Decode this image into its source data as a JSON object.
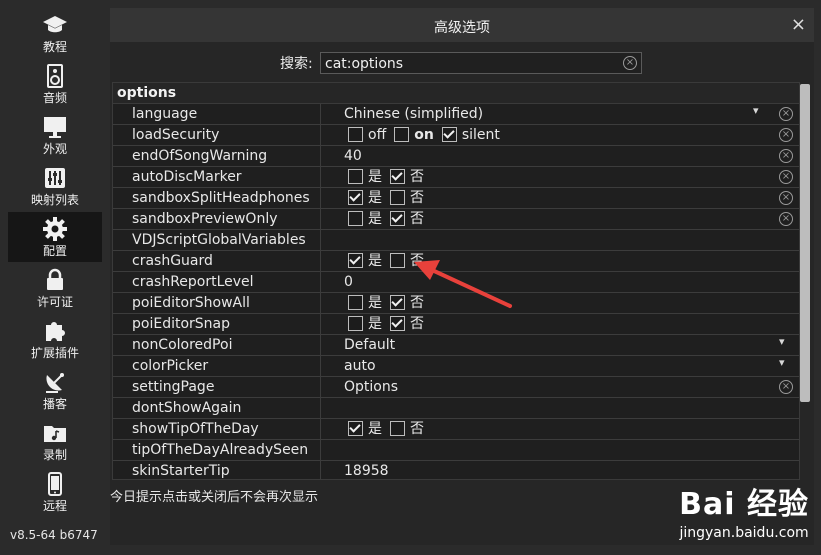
{
  "sidebar": {
    "items": [
      {
        "label": "教程",
        "icon": "graduation-cap-icon"
      },
      {
        "label": "音频",
        "icon": "speaker-icon"
      },
      {
        "label": "外观",
        "icon": "monitor-icon"
      },
      {
        "label": "映射列表",
        "icon": "sliders-icon"
      },
      {
        "label": "配置",
        "icon": "gear-icon",
        "active": true
      },
      {
        "label": "许可证",
        "icon": "lock-icon"
      },
      {
        "label": "扩展插件",
        "icon": "puzzle-icon"
      },
      {
        "label": "播客",
        "icon": "satellite-dish-icon"
      },
      {
        "label": "录制",
        "icon": "folder-music-icon"
      },
      {
        "label": "远程",
        "icon": "phone-icon"
      }
    ],
    "version": "v8.5-64 b6747"
  },
  "dialog": {
    "title": "高级选项",
    "close": "×",
    "search_label": "搜索:",
    "search_value": "cat:options",
    "section": "options",
    "footer": "今日提示点击或关闭后不会再次显示"
  },
  "rows": [
    {
      "name": "language",
      "kind": "select",
      "value": "Chinese (simplified)",
      "clear": true
    },
    {
      "name": "loadSecurity",
      "kind": "options",
      "options": [
        {
          "label": "off",
          "checked": false
        },
        {
          "label": "on",
          "checked": false,
          "bold": true
        },
        {
          "label": "silent",
          "checked": true
        }
      ],
      "clear": true
    },
    {
      "name": "endOfSongWarning",
      "kind": "text",
      "value": "40",
      "clear": true
    },
    {
      "name": "autoDiscMarker",
      "kind": "options",
      "options": [
        {
          "label": "是",
          "checked": false
        },
        {
          "label": "否",
          "checked": true
        }
      ],
      "clear": true
    },
    {
      "name": "sandboxSplitHeadphones",
      "kind": "options",
      "options": [
        {
          "label": "是",
          "checked": true
        },
        {
          "label": "否",
          "checked": false
        }
      ],
      "clear": true
    },
    {
      "name": "sandboxPreviewOnly",
      "kind": "options",
      "options": [
        {
          "label": "是",
          "checked": false
        },
        {
          "label": "否",
          "checked": true
        }
      ],
      "clear": true
    },
    {
      "name": "VDJScriptGlobalVariables",
      "kind": "text",
      "value": "",
      "clear": false
    },
    {
      "name": "crashGuard",
      "kind": "options",
      "options": [
        {
          "label": "是",
          "checked": true
        },
        {
          "label": "否",
          "checked": false
        }
      ],
      "clear": false
    },
    {
      "name": "crashReportLevel",
      "kind": "text",
      "value": "0",
      "clear": false
    },
    {
      "name": "poiEditorShowAll",
      "kind": "options",
      "options": [
        {
          "label": "是",
          "checked": false
        },
        {
          "label": "否",
          "checked": true
        }
      ],
      "clear": false
    },
    {
      "name": "poiEditorSnap",
      "kind": "options",
      "options": [
        {
          "label": "是",
          "checked": false
        },
        {
          "label": "否",
          "checked": true
        }
      ],
      "clear": false
    },
    {
      "name": "nonColoredPoi",
      "kind": "select",
      "value": "Default",
      "clear": false
    },
    {
      "name": "colorPicker",
      "kind": "select",
      "value": "auto",
      "clear": false
    },
    {
      "name": "settingPage",
      "kind": "text",
      "value": "Options",
      "clear": true
    },
    {
      "name": "dontShowAgain",
      "kind": "text",
      "value": "",
      "clear": false
    },
    {
      "name": "showTipOfTheDay",
      "kind": "options",
      "options": [
        {
          "label": "是",
          "checked": true
        },
        {
          "label": "否",
          "checked": false
        }
      ],
      "clear": false
    },
    {
      "name": "tipOfTheDayAlreadySeen",
      "kind": "text",
      "value": "",
      "clear": false
    },
    {
      "name": "skinStarterTip",
      "kind": "text",
      "value": "18958",
      "clear": false
    }
  ],
  "watermark": {
    "brand": "Bai 经验",
    "url": "jingyan.baidu.com"
  },
  "colors": {
    "background": "#2b2b2b",
    "table": "#1f1f1f",
    "arrow": "#e8413b"
  }
}
